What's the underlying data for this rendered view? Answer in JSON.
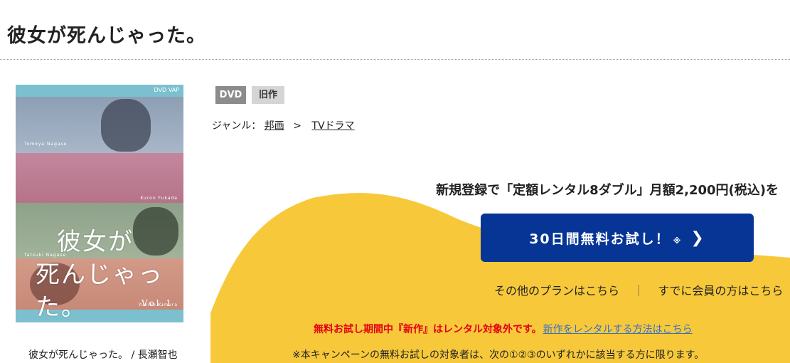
{
  "page": {
    "title": "彼女が死んじゃった。"
  },
  "cover": {
    "logo": "DVD VAP",
    "title_line1": "彼女が",
    "title_line2": "死んじゃった。",
    "volume": "Vol.1",
    "cast_names": [
      "Tomoya Nagase",
      "Kuron Fukada",
      "Tatsuki Nagase",
      "Yukiko Kimura"
    ]
  },
  "caption": "彼女が死んじゃった。 / 長瀬智也",
  "tags": {
    "format": "DVD",
    "age": "旧作"
  },
  "genre": {
    "label": "ジャンル：",
    "crumb1": "邦画",
    "separator": ">",
    "crumb2": "TVドラマ"
  },
  "promo": {
    "text": "新規登録で「定額レンタル8ダブル」月額2,200円(税込)を",
    "cta_label": "30日間無料お試し！",
    "cta_note": "※",
    "cta_chevron": "❯"
  },
  "links": {
    "other_plans": "その他のプランはこちら",
    "bar": "｜",
    "members": "すでに会員の方はこちら"
  },
  "warning": {
    "text": "無料お試し期間中『新作』はレンタル対象外です。",
    "link": "新作をレンタルする方法はこちら"
  },
  "terms": "※本キャンペーンの無料お試しの対象者は、次の①②③のいずれかに該当する方に限ります。",
  "colors": {
    "cta": "#063596",
    "yellow": "#f7c93a",
    "warning_red": "#e60012",
    "link_blue": "#3a6fc4"
  }
}
